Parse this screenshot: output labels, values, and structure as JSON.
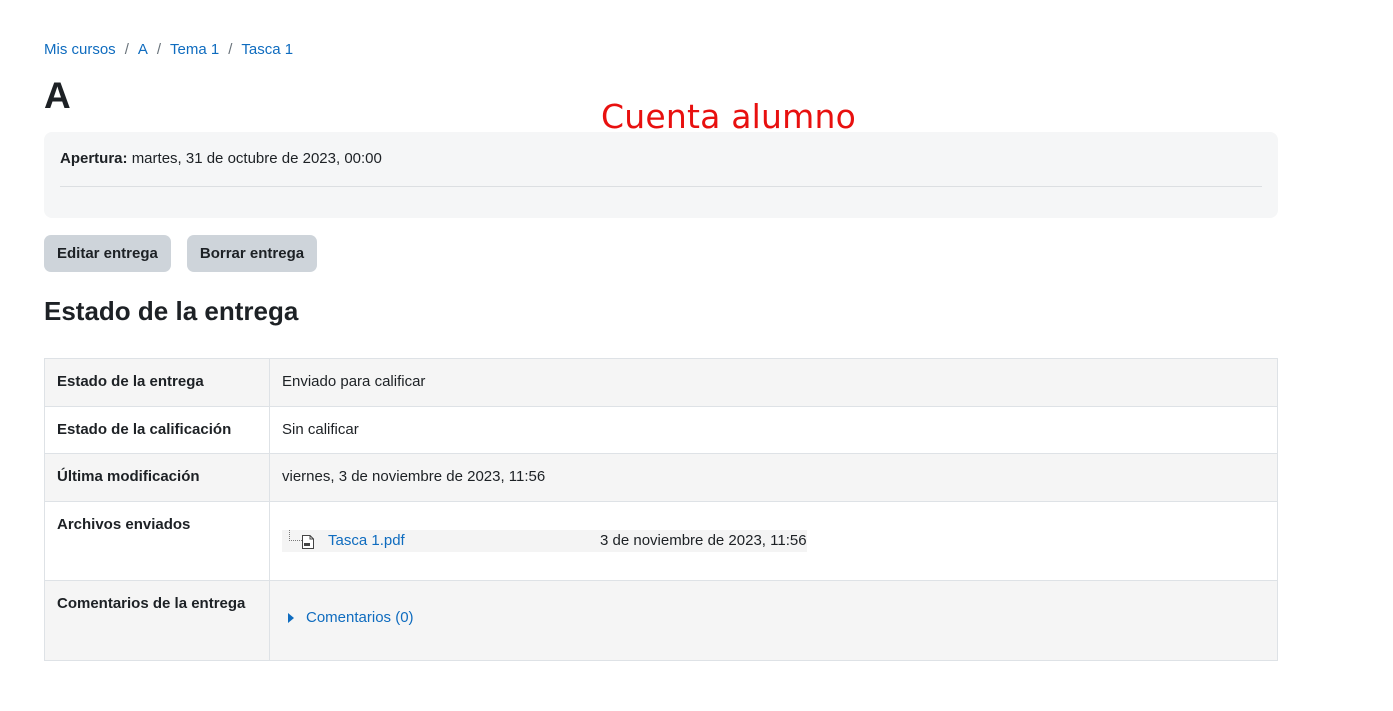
{
  "breadcrumb": {
    "items": [
      "Mis cursos",
      "A",
      "Tema 1",
      "Tasca 1"
    ],
    "separator": "/"
  },
  "page": {
    "title": "A"
  },
  "overlay_note": "Cuenta alumno",
  "dates": {
    "opening_label": "Apertura:",
    "opening_value": "martes, 31 de octubre de 2023, 00:00"
  },
  "actions": {
    "edit_label": "Editar entrega",
    "delete_label": "Borrar entrega"
  },
  "section": {
    "title": "Estado de la entrega"
  },
  "status_table": {
    "rows": [
      {
        "label": "Estado de la entrega",
        "value": "Enviado para calificar"
      },
      {
        "label": "Estado de la calificación",
        "value": "Sin calificar"
      },
      {
        "label": "Última modificación",
        "value": "viernes, 3 de noviembre de 2023, 11:56"
      },
      {
        "label": "Archivos enviados",
        "file_name": "Tasca 1.pdf",
        "file_date": "3 de noviembre de 2023, 11:56"
      },
      {
        "label": "Comentarios de la entrega",
        "comments_link": "Comentarios (0)"
      }
    ]
  },
  "colors": {
    "link": "#0f6cbf",
    "submitted_bg": "#cfefcf",
    "overlay_text": "#e8100f",
    "button_bg": "#ced4da"
  },
  "icons": {
    "file": "pdf-file-icon",
    "toggle": "caret-right-icon"
  }
}
